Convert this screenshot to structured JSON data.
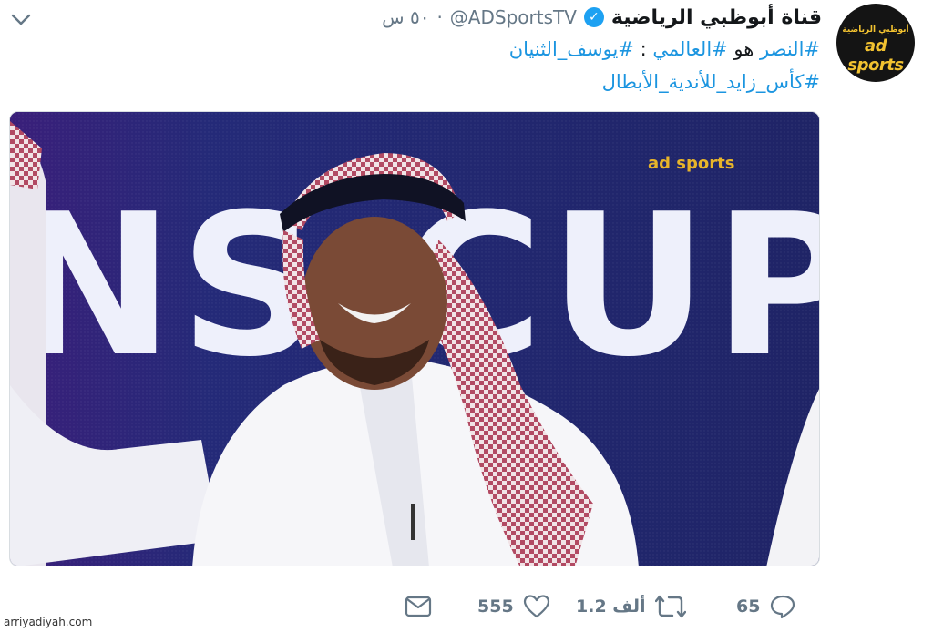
{
  "tweet": {
    "display_name": "قناة أبوظبي الرياضية",
    "handle": "@ADSportsTV",
    "separator": "·",
    "time": "٥٠ س",
    "verified": true,
    "avatar": {
      "logo_top_text": "أبوظبي الرياضية",
      "logo_main_text": "ad sports"
    },
    "text_lines": [
      [
        {
          "type": "hashtag",
          "text": "#النصر"
        },
        {
          "type": "text",
          "text": " هو "
        },
        {
          "type": "hashtag",
          "text": "#العالمي"
        },
        {
          "type": "text",
          "text": " : "
        },
        {
          "type": "hashtag",
          "text": "#يوسف_الثنيان"
        }
      ],
      [
        {
          "type": "hashtag",
          "text": "#كأس_زايد_للأندية_الأبطال"
        }
      ]
    ],
    "media": {
      "background_text": "NS CUP",
      "channel_logo_text": "ad sports"
    },
    "actions": {
      "reply_count": "65",
      "retweet_count": "1.2 ألف",
      "like_count": "555"
    }
  },
  "watermark": "arriyadiyah.com",
  "colors": {
    "hashtag": "#1b95e0",
    "verified": "#1da1f2",
    "muted": "#657786",
    "avatar_bg": "#141414",
    "logo": "#f2c230"
  }
}
